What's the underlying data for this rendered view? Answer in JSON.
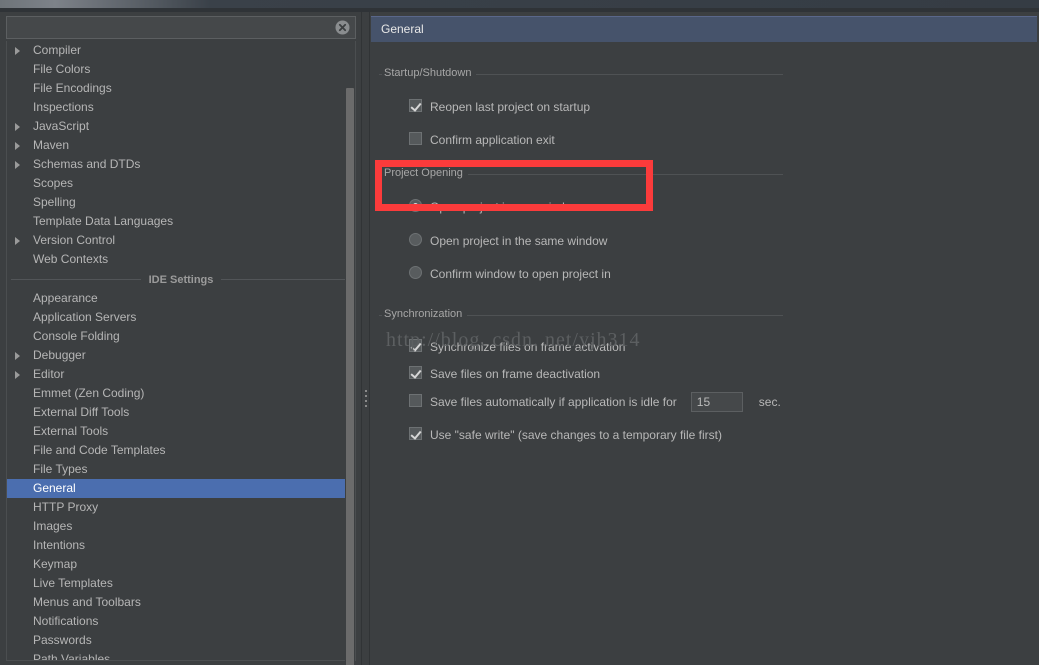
{
  "window": {
    "title_strip": ""
  },
  "sidebar": {
    "search": {
      "value": "",
      "placeholder": "",
      "clear_icon": "clear-circle-icon"
    },
    "items": [
      {
        "label": "Compiler",
        "expandable": true,
        "selected": false
      },
      {
        "label": "File Colors",
        "expandable": false,
        "selected": false
      },
      {
        "label": "File Encodings",
        "expandable": false,
        "selected": false
      },
      {
        "label": "Inspections",
        "expandable": false,
        "selected": false
      },
      {
        "label": "JavaScript",
        "expandable": true,
        "selected": false
      },
      {
        "label": "Maven",
        "expandable": true,
        "selected": false
      },
      {
        "label": "Schemas and DTDs",
        "expandable": true,
        "selected": false
      },
      {
        "label": "Scopes",
        "expandable": false,
        "selected": false
      },
      {
        "label": "Spelling",
        "expandable": false,
        "selected": false
      },
      {
        "label": "Template Data Languages",
        "expandable": false,
        "selected": false
      },
      {
        "label": "Version Control",
        "expandable": true,
        "selected": false
      },
      {
        "label": "Web Contexts",
        "expandable": false,
        "selected": false
      }
    ],
    "separator_label": "IDE Settings",
    "ide_items": [
      {
        "label": "Appearance",
        "expandable": false,
        "selected": false
      },
      {
        "label": "Application Servers",
        "expandable": false,
        "selected": false
      },
      {
        "label": "Console Folding",
        "expandable": false,
        "selected": false
      },
      {
        "label": "Debugger",
        "expandable": true,
        "selected": false
      },
      {
        "label": "Editor",
        "expandable": true,
        "selected": false
      },
      {
        "label": "Emmet (Zen Coding)",
        "expandable": false,
        "selected": false
      },
      {
        "label": "External Diff Tools",
        "expandable": false,
        "selected": false
      },
      {
        "label": "External Tools",
        "expandable": false,
        "selected": false
      },
      {
        "label": "File and Code Templates",
        "expandable": false,
        "selected": false
      },
      {
        "label": "File Types",
        "expandable": false,
        "selected": false
      },
      {
        "label": "General",
        "expandable": false,
        "selected": true
      },
      {
        "label": "HTTP Proxy",
        "expandable": false,
        "selected": false
      },
      {
        "label": "Images",
        "expandable": false,
        "selected": false
      },
      {
        "label": "Intentions",
        "expandable": false,
        "selected": false
      },
      {
        "label": "Keymap",
        "expandable": false,
        "selected": false
      },
      {
        "label": "Live Templates",
        "expandable": false,
        "selected": false
      },
      {
        "label": "Menus and Toolbars",
        "expandable": false,
        "selected": false
      },
      {
        "label": "Notifications",
        "expandable": false,
        "selected": false
      },
      {
        "label": "Passwords",
        "expandable": false,
        "selected": false
      },
      {
        "label": "Path Variables",
        "expandable": false,
        "selected": false
      }
    ]
  },
  "panel": {
    "title": "General",
    "groups": [
      {
        "name": "startup-shutdown",
        "title": "Startup/Shutdown",
        "options": [
          {
            "type": "checkbox",
            "label": "Reopen last project on startup",
            "checked": true
          },
          {
            "type": "checkbox",
            "label": "Confirm application exit",
            "checked": false
          }
        ]
      },
      {
        "name": "project-opening",
        "title": "Project Opening",
        "options": [
          {
            "type": "radio",
            "label": "Open project in new window",
            "checked": true
          },
          {
            "type": "radio",
            "label": "Open project in the same window",
            "checked": false
          },
          {
            "type": "radio",
            "label": "Confirm window to open project in",
            "checked": false
          }
        ]
      },
      {
        "name": "synchronization",
        "title": "Synchronization",
        "options": [
          {
            "type": "checkbox",
            "label": "Synchronize files on frame activation",
            "checked": true
          },
          {
            "type": "checkbox",
            "label": "Save files on frame deactivation",
            "checked": true
          },
          {
            "type": "checkbox",
            "label": "Save files automatically if application is idle for",
            "checked": false,
            "field_value": "15",
            "suffix": "sec."
          },
          {
            "type": "checkbox",
            "label": "Use \"safe write\" (save changes to a temporary file first)",
            "checked": true
          }
        ]
      }
    ]
  },
  "annotation": {
    "highlight_color": "#fb3b3b",
    "target": "Open project in new window"
  },
  "watermark": {
    "text": "http://blog. csdn. net/yjh314"
  },
  "colors": {
    "background": "#3c3f41",
    "panel_header": "#46536b",
    "selection": "#4b6eaf",
    "text": "#b8b8b8",
    "border": "#5c5f61"
  }
}
